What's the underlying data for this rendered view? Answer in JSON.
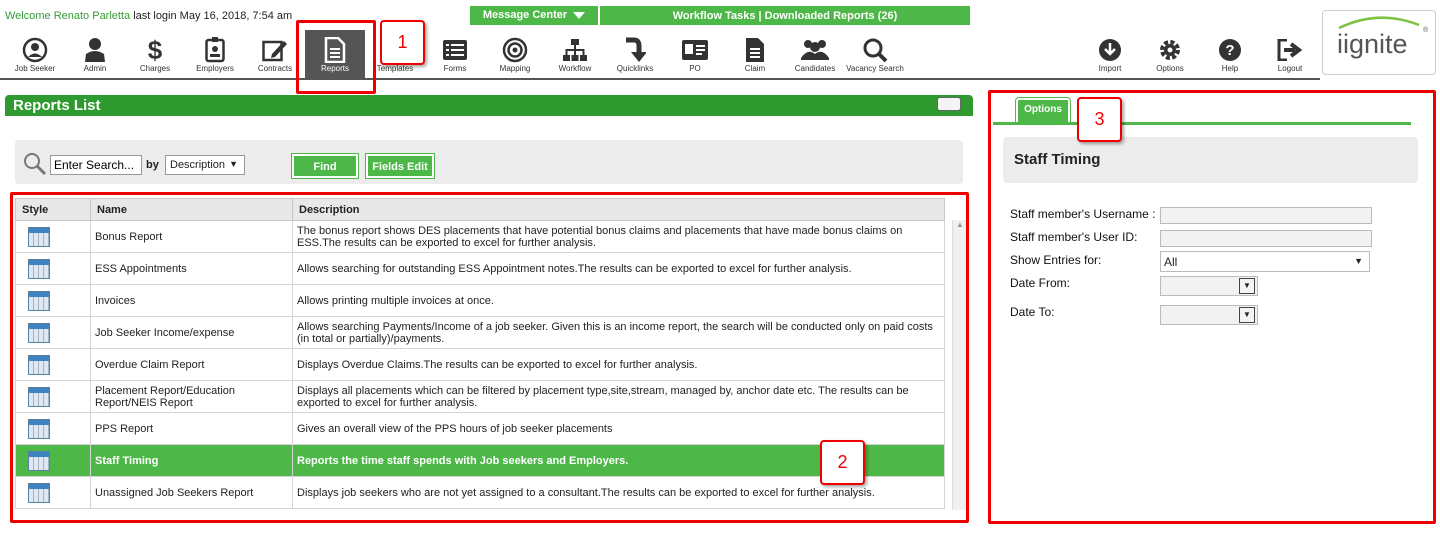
{
  "header": {
    "welcome_prefix": "Welcome ",
    "user_name": "Renato Parletta",
    "last_login": " last login May 16, 2018, 7:54 am",
    "message_center": "Message Center",
    "workflow_tasks": "Workflow Tasks | Downloaded Reports (26)"
  },
  "nav": {
    "items": [
      {
        "label": "Job Seeker",
        "icon": "user-circle-icon"
      },
      {
        "label": "Admin",
        "icon": "admin-person-icon"
      },
      {
        "label": "Charges",
        "icon": "dollar-icon"
      },
      {
        "label": "Employers",
        "icon": "id-badge-icon"
      },
      {
        "label": "Contracts",
        "icon": "edit-icon"
      },
      {
        "label": "Reports",
        "icon": "report-document-icon"
      },
      {
        "label": "Templates",
        "icon": "template-icon"
      },
      {
        "label": "Forms",
        "icon": "form-list-icon"
      },
      {
        "label": "Mapping",
        "icon": "target-icon"
      },
      {
        "label": "Workflow",
        "icon": "sitemap-icon"
      },
      {
        "label": "Quicklinks",
        "icon": "arrow-down-turn-icon"
      },
      {
        "label": "PO",
        "icon": "id-card-icon"
      },
      {
        "label": "Claim",
        "icon": "document-icon"
      },
      {
        "label": "Candidates",
        "icon": "users-icon"
      },
      {
        "label": "Vacancy Search",
        "icon": "search-icon"
      }
    ],
    "right_items": [
      {
        "label": "Import",
        "icon": "download-circle-icon"
      },
      {
        "label": "Options",
        "icon": "gear-icon"
      },
      {
        "label": "Help",
        "icon": "question-icon"
      },
      {
        "label": "Logout",
        "icon": "logout-icon"
      }
    ],
    "active": "Reports"
  },
  "logo": {
    "text": "iignite",
    "reg": "®"
  },
  "callouts": {
    "one": "1",
    "two": "2",
    "three": "3"
  },
  "reports_list": {
    "title": "Reports List",
    "search_placeholder": "Enter Search...",
    "by_label": "by",
    "search_by": "Description",
    "find_label": "Find",
    "fields_edit_label": "Fields Edit",
    "columns": [
      "Style",
      "Name",
      "Description"
    ],
    "rows": [
      {
        "name": "Bonus Report",
        "description": "The bonus report shows DES placements that have potential bonus claims and placements that have made bonus claims on ESS.The results can be exported to excel for further analysis."
      },
      {
        "name": "ESS Appointments",
        "description": "Allows searching for outstanding ESS Appointment notes.The results can be exported to excel for further analysis."
      },
      {
        "name": "Invoices",
        "description": "Allows printing multiple invoices at once."
      },
      {
        "name": "Job Seeker Income/expense",
        "description": "Allows searching Payments/Income of a job seeker. Given this is an income report, the search will be conducted only on paid costs (in total or partially)/payments."
      },
      {
        "name": "Overdue Claim Report",
        "description": "Displays Overdue Claims.The results can be exported to excel for further analysis."
      },
      {
        "name": "Placement Report/Education Report/NEIS Report",
        "description": "Displays all placements which can be filtered by placement type,site,stream, managed by, anchor date etc. The results can be exported to excel for further analysis."
      },
      {
        "name": "PPS Report",
        "description": "Gives an overall view of the PPS hours of job seeker placements"
      },
      {
        "name": "Staff Timing",
        "description": "Reports the time staff spends with Job seekers and Employers."
      },
      {
        "name": "Unassigned Job Seekers Report",
        "description": "Displays job seekers who are not yet assigned to a consultant.The results can be exported to excel for further analysis."
      }
    ],
    "selected_index": 7
  },
  "options": {
    "tab_label": "Options",
    "panel_title": "Staff Timing",
    "username_label": "Staff member's Username :",
    "userid_label": "Staff member's User ID:",
    "show_entries_label": "Show Entries for:",
    "show_entries_value": "All",
    "date_from_label": "Date From:",
    "date_to_label": "Date To:"
  },
  "colors": {
    "green": "#4db848",
    "dark_green": "#2f9a2f",
    "callout_red": "#e00000"
  }
}
